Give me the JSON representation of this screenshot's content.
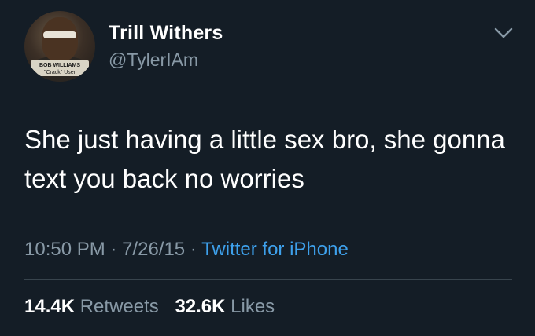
{
  "user": {
    "display_name": "Trill Withers",
    "handle": "@TylerIAm",
    "avatar_caption_line1": "BOB WILLIAMS",
    "avatar_caption_line2": "\"Crack\" User"
  },
  "tweet": {
    "text": "She just having a little sex bro, she gonna text you back no worries",
    "time": "10:50 PM",
    "date": "7/26/15",
    "separator": "·",
    "source": "Twitter for iPhone"
  },
  "stats": {
    "retweets_count": "14.4K",
    "retweets_label": "Retweets",
    "likes_count": "32.6K",
    "likes_label": "Likes"
  },
  "icons": {
    "menu": "chevron-down-icon"
  },
  "colors": {
    "background": "#141d26",
    "primary_text": "#ffffff",
    "secondary_text": "#8899a6",
    "link": "#3ea1ec",
    "divider": "#38444d"
  }
}
